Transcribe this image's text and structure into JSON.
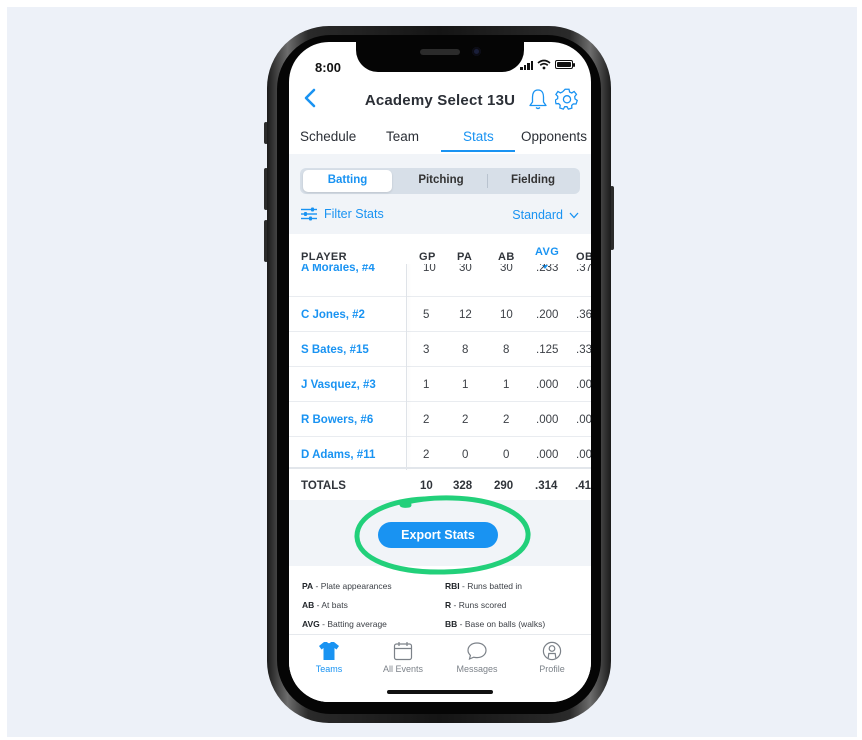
{
  "status": {
    "time": "8:00"
  },
  "header": {
    "title": "Academy Select 13U"
  },
  "tabs": [
    {
      "label": "Schedule"
    },
    {
      "label": "Team"
    },
    {
      "label": "Stats"
    },
    {
      "label": "Opponents"
    }
  ],
  "segment": [
    "Batting",
    "Pitching",
    "Fielding"
  ],
  "filter": {
    "label": "Filter Stats",
    "view": "Standard"
  },
  "table": {
    "columns": [
      "PLAYER",
      "GP",
      "PA",
      "AB",
      "AVG",
      "OB"
    ],
    "partial_row": {
      "name": "A Morales, #4",
      "gp": "10",
      "pa": "30",
      "ab": "30",
      "avg": ".233",
      "ob": ".37"
    },
    "rows": [
      {
        "name": "C Jones, #2",
        "gp": "5",
        "pa": "12",
        "ab": "10",
        "avg": ".200",
        "ob": ".36"
      },
      {
        "name": "S Bates, #15",
        "gp": "3",
        "pa": "8",
        "ab": "8",
        "avg": ".125",
        "ob": ".33"
      },
      {
        "name": "J Vasquez, #3",
        "gp": "1",
        "pa": "1",
        "ab": "1",
        "avg": ".000",
        "ob": ".00"
      },
      {
        "name": "R Bowers, #6",
        "gp": "2",
        "pa": "2",
        "ab": "2",
        "avg": ".000",
        "ob": ".00"
      },
      {
        "name": "D Adams, #11",
        "gp": "2",
        "pa": "0",
        "ab": "0",
        "avg": ".000",
        "ob": ".00"
      }
    ],
    "totals": {
      "label": "TOTALS",
      "gp": "10",
      "pa": "328",
      "ab": "290",
      "avg": ".314",
      "ob": ".41"
    }
  },
  "export": {
    "label": "Export Stats"
  },
  "legend": [
    {
      "abbr": "PA",
      "desc": " - Plate appearances"
    },
    {
      "abbr": "RBI",
      "desc": " - Runs batted in"
    },
    {
      "abbr": "AB",
      "desc": " - At bats"
    },
    {
      "abbr": "R",
      "desc": " - Runs scored"
    },
    {
      "abbr": "AVG",
      "desc": " - Batting average"
    },
    {
      "abbr": "BB",
      "desc": " - Base on balls (walks)"
    }
  ],
  "nav": [
    {
      "label": "Teams",
      "icon": "jersey-icon"
    },
    {
      "label": "All Events",
      "icon": "calendar-icon"
    },
    {
      "label": "Messages",
      "icon": "chat-bubble-icon"
    },
    {
      "label": "Profile",
      "icon": "profile-icon"
    }
  ],
  "colors": {
    "accent": "#1993f2",
    "highlight_circle": "#22d07a",
    "background": "#edf1f8"
  }
}
